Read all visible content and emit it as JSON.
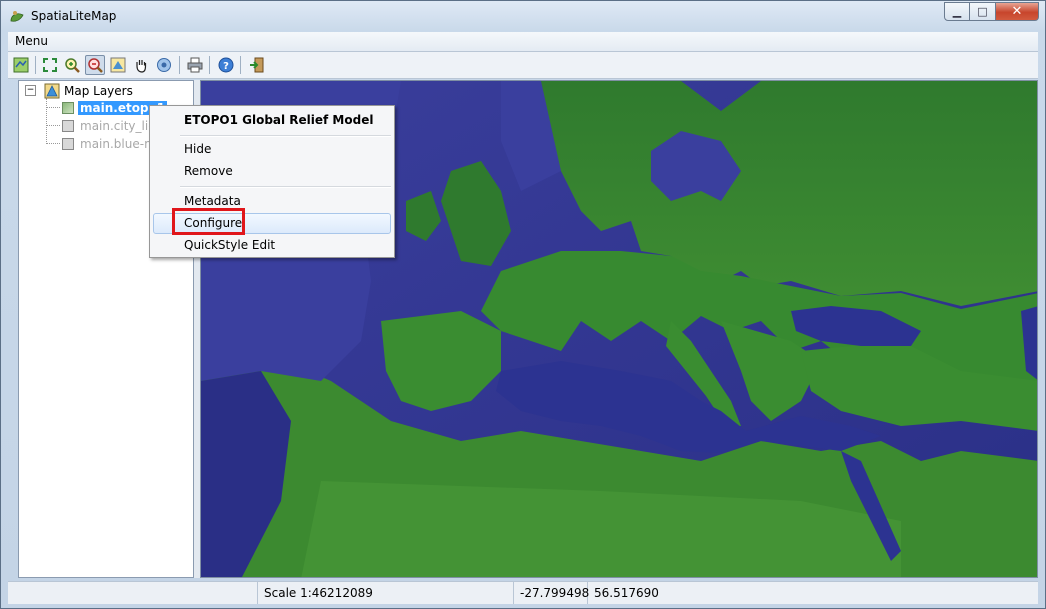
{
  "window": {
    "title": "SpatiaLiteMap",
    "minimize_glyph": "▁",
    "maximize_glyph": "□",
    "close_glyph": "✕"
  },
  "menubar": {
    "menu_label": "Menu"
  },
  "toolbar": {
    "buttons": [
      {
        "name": "add-layer-icon"
      },
      {
        "name": "zoom-full-icon"
      },
      {
        "name": "zoom-in-icon"
      },
      {
        "name": "zoom-out-icon"
      },
      {
        "name": "map-properties-icon"
      },
      {
        "name": "pan-hand-icon"
      },
      {
        "name": "identify-icon"
      },
      {
        "name": "print-icon"
      },
      {
        "name": "help-icon"
      },
      {
        "name": "exit-icon"
      }
    ]
  },
  "tree": {
    "root_label": "Map Layers",
    "collapse_glyph": "−",
    "layers": [
      {
        "label": "main.etopo1",
        "selected": true,
        "visible": true
      },
      {
        "label": "main.city_lig",
        "selected": false,
        "visible": false
      },
      {
        "label": "main.blue-m",
        "selected": false,
        "visible": false
      }
    ]
  },
  "context_menu": {
    "title": "ETOPO1 Global Relief Model",
    "items": [
      "Hide",
      "Remove",
      "Metadata",
      "Configure",
      "QuickStyle Edit"
    ],
    "hovered": "Configure"
  },
  "statusbar": {
    "scale": "Scale 1:46212089",
    "coord_x": "-27.799498",
    "coord_y": "56.517690"
  },
  "colors": {
    "sea": "#3b3f9e",
    "land": "#2f7d2e",
    "highlight_border": "#e0161b",
    "selection": "#3399ff"
  }
}
